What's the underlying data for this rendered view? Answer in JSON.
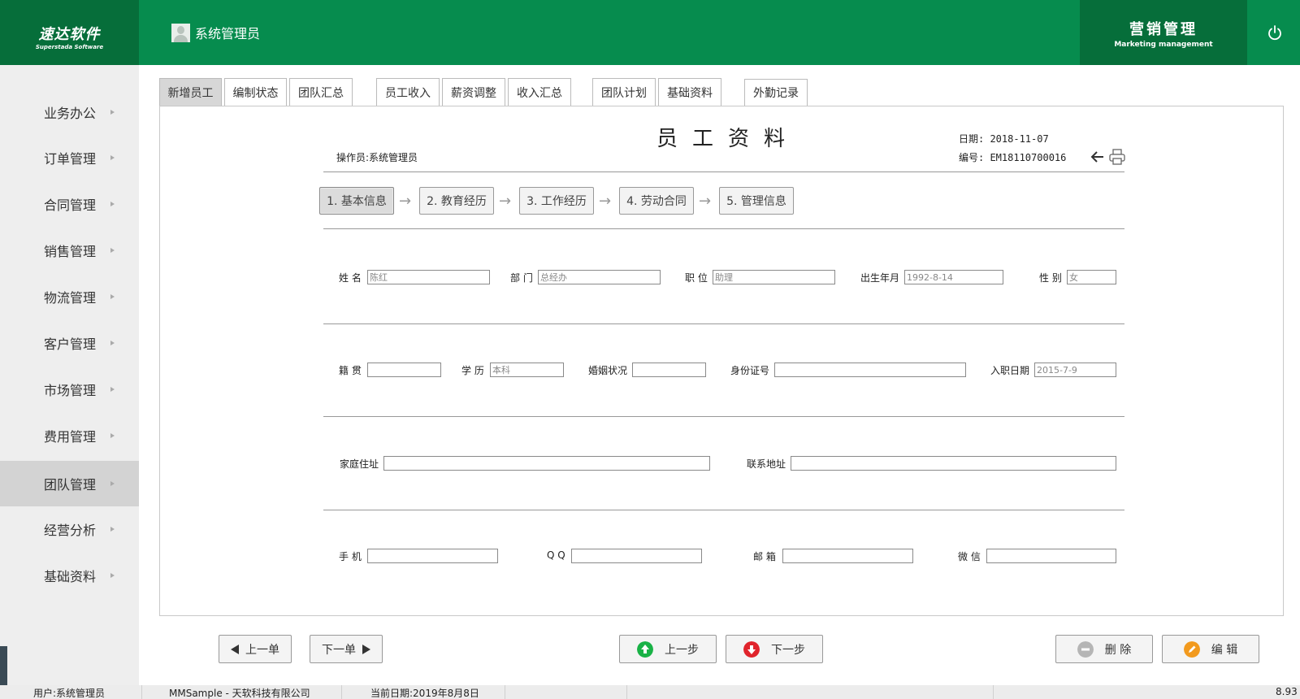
{
  "header": {
    "logo_cn": "速达软件",
    "logo_en": "Superstada Software",
    "user": "系统管理员",
    "module_cn": "营销管理",
    "module_en": "Marketing management"
  },
  "sidebar": {
    "items": [
      {
        "label": "业务办公"
      },
      {
        "label": "订单管理"
      },
      {
        "label": "合同管理"
      },
      {
        "label": "销售管理"
      },
      {
        "label": "物流管理"
      },
      {
        "label": "客户管理"
      },
      {
        "label": "市场管理"
      },
      {
        "label": "费用管理"
      },
      {
        "label": "团队管理",
        "active": true
      },
      {
        "label": "经营分析"
      },
      {
        "label": "基础资料"
      }
    ]
  },
  "tabs": [
    {
      "label": "新增员工",
      "active": true
    },
    {
      "label": "编制状态"
    },
    {
      "label": "团队汇总"
    },
    {
      "label": "员工收入"
    },
    {
      "label": "薪资调整"
    },
    {
      "label": "收入汇总"
    },
    {
      "label": "团队计划"
    },
    {
      "label": "基础资料"
    },
    {
      "label": "外勤记录"
    }
  ],
  "document": {
    "title": "员工资料",
    "operator": "操作员:系统管理员",
    "date": "日期: 2018-11-07",
    "number": "编号: EM18110700016"
  },
  "steps": [
    {
      "label": "1. 基本信息",
      "active": true
    },
    {
      "label": "2. 教育经历"
    },
    {
      "label": "3. 工作经历"
    },
    {
      "label": "4. 劳动合同"
    },
    {
      "label": "5. 管理信息"
    }
  ],
  "step_arrow": "→",
  "fields": {
    "name": {
      "label": "姓 名",
      "value": "陈红"
    },
    "department": {
      "label": "部 门",
      "value": "总经办"
    },
    "position": {
      "label": "职 位",
      "value": "助理"
    },
    "birth": {
      "label": "出生年月",
      "value": "1992-8-14"
    },
    "gender": {
      "label": "性 别",
      "value": "女"
    },
    "native_place": {
      "label": "籍 贯",
      "value": ""
    },
    "education": {
      "label": "学 历",
      "value": "本科"
    },
    "marital": {
      "label": "婚姻状况",
      "value": ""
    },
    "id_card": {
      "label": "身份证号",
      "value": ""
    },
    "hire_date": {
      "label": "入职日期",
      "value": "2015-7-9"
    },
    "home_address": {
      "label": "家庭住址",
      "value": ""
    },
    "contact_address": {
      "label": "联系地址",
      "value": ""
    },
    "mobile": {
      "label": "手 机",
      "value": ""
    },
    "qq": {
      "label": "Q Q",
      "value": ""
    },
    "email": {
      "label": "邮 箱",
      "value": ""
    },
    "wechat": {
      "label": "微 信",
      "value": ""
    }
  },
  "buttons": {
    "prev_record": "上一单",
    "next_record": "下一单",
    "prev_step": "上一步",
    "next_step": "下一步",
    "delete": "删 除",
    "edit": "编 辑"
  },
  "status_bar": {
    "user": "用户:系统管理员",
    "company": "MMSample - 天软科技有限公司",
    "current_date": "当前日期:2019年8月8日",
    "version": "8.93"
  },
  "colors": {
    "header_green": "#068c4e",
    "dark_green": "#066e3a",
    "up_green": "#19b246",
    "down_red": "#e0242c",
    "edit_orange": "#f29a1e"
  }
}
